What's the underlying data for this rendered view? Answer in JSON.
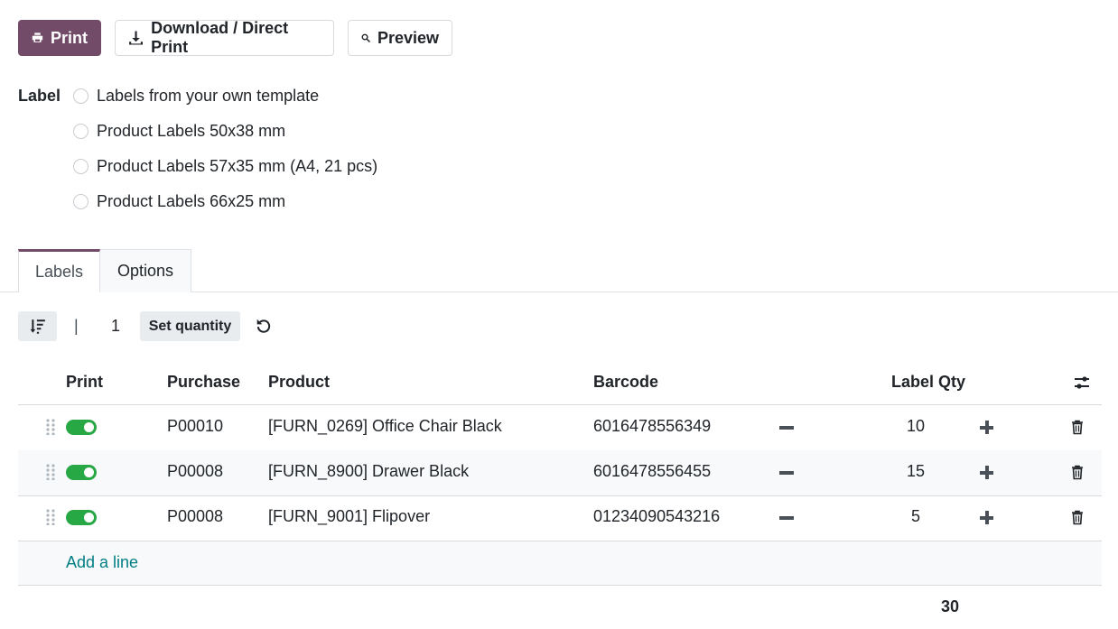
{
  "toolbar": {
    "print_label": "Print",
    "download_label": "Download / Direct Print",
    "preview_label": "Preview"
  },
  "label_section": {
    "heading": "Label",
    "options": [
      "Labels from your own template",
      "Product Labels 50x38 mm",
      "Product Labels 57x35 mm (A4, 21 pcs)",
      "Product Labels 66x25 mm"
    ]
  },
  "tabs": [
    {
      "label": "Labels",
      "active": true
    },
    {
      "label": "Options",
      "active": false
    }
  ],
  "list_toolbar": {
    "separator": "|",
    "quantity": "1",
    "set_quantity_label": "Set quantity"
  },
  "table": {
    "columns": {
      "print": "Print",
      "purchase": "Purchase",
      "product": "Product",
      "barcode": "Barcode",
      "label_qty": "Label Qty"
    },
    "rows": [
      {
        "print": true,
        "purchase": "P00010",
        "product": "[FURN_0269] Office Chair Black",
        "barcode": "6016478556349",
        "label_qty": "10"
      },
      {
        "print": true,
        "purchase": "P00008",
        "product": "[FURN_8900] Drawer Black",
        "barcode": "6016478556455",
        "label_qty": "15"
      },
      {
        "print": true,
        "purchase": "P00008",
        "product": "[FURN_9001] Flipover",
        "barcode": "01234090543216",
        "label_qty": "5"
      }
    ],
    "add_line_label": "Add a line",
    "total_label_qty": "30"
  },
  "colors": {
    "brand": "#714b67",
    "toggle_on": "#28a745",
    "link": "#017e84"
  }
}
